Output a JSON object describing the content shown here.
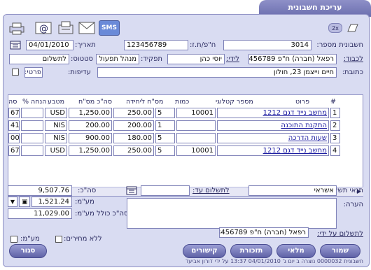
{
  "window": {
    "title": "עריכת חשבונית"
  },
  "toolbar": {
    "badge": "2x",
    "sms_label": "SMS"
  },
  "header": {
    "invoice_number_label": "חשבונית מספר:",
    "invoice_number": "3014",
    "tax_id_label": "ח\"פ/ת.ז:",
    "tax_id": "123456789",
    "date_label": "תאריך:",
    "date": "04/01/2010",
    "to_label": "לכבוד:",
    "to_value": "רפאל (חברה) ח\"פ 123456789",
    "attn_label": "לידי:",
    "attn_value": "יוסי כהן",
    "role_label": "תפקיד:",
    "role_value": "מנהל תפעול",
    "status_label": "סטטוס:",
    "status_value": "לתשלום",
    "address_label": "כתובת:",
    "address_value": "חיים וייצמן 23, חולון",
    "priority_label": "עדיפות:",
    "details_label": "פרטי:"
  },
  "table": {
    "headers": [
      "#",
      "פרוט",
      "מספר קטלוגי",
      "כמות",
      "מס\"ח ליחידה",
      "סה\"כ מס\"ח",
      "מטבע",
      "% הנחה",
      "סה"
    ],
    "rows": [
      {
        "num": "1",
        "desc": "מחשב נייד דגם 1212",
        "catalog": "10001",
        "qty": "5",
        "unit": "250.00",
        "total": "1,250.00",
        "currency": "USD",
        "discount": "",
        "sum": "67"
      },
      {
        "num": "2",
        "desc": "התקנת התוכנה",
        "catalog": "",
        "qty": "1",
        "unit": "200.00",
        "total": "200.00",
        "currency": "NIS",
        "discount": "",
        "sum": "41"
      },
      {
        "num": "3",
        "desc": "שעות הדרכה",
        "catalog": "",
        "qty": "5",
        "unit": "180.00",
        "total": "900.00",
        "currency": "NIS",
        "discount": "",
        "sum": "00"
      },
      {
        "num": "4",
        "desc": "מחשב נייד דגם 1212",
        "catalog": "10001",
        "qty": "5",
        "unit": "250.00",
        "total": "1,250.00",
        "currency": "USD",
        "discount": "",
        "sum": "67"
      }
    ]
  },
  "totals": {
    "total_label": "סה\"כ:",
    "total": "9,507.76",
    "vat_label": "מע\"מ:",
    "vat": "1,521.24",
    "grand_label": "סה\"כ כולל מע\"מ:",
    "grand": "11,029.00"
  },
  "payment": {
    "terms_label": "תנאי תשלום:",
    "terms_value": "אשראי",
    "pay_until_label": "לתשלום עד:",
    "note_label": "הערה:",
    "payer_label": "לתשלום על ידי:",
    "payer_value": "רפאל (חברה) ח\"פ 123456789"
  },
  "options": {
    "no_prices_label": "ללא מחירים:",
    "vat_label": "מע\"מ:"
  },
  "buttons": {
    "save": "שמור",
    "stock": "מלאי",
    "reminder": "תזכורת",
    "links": "קישורים",
    "close": "סגור"
  },
  "footer": {
    "text": "חשבונית 0000032 נוצרה ב יום ג' 04/01/2010 13:37 על ידי דורון אביעד"
  },
  "colors": {
    "accent": "#6b6eae",
    "panel": "#d9dcf2",
    "link": "#1a1aa0"
  }
}
